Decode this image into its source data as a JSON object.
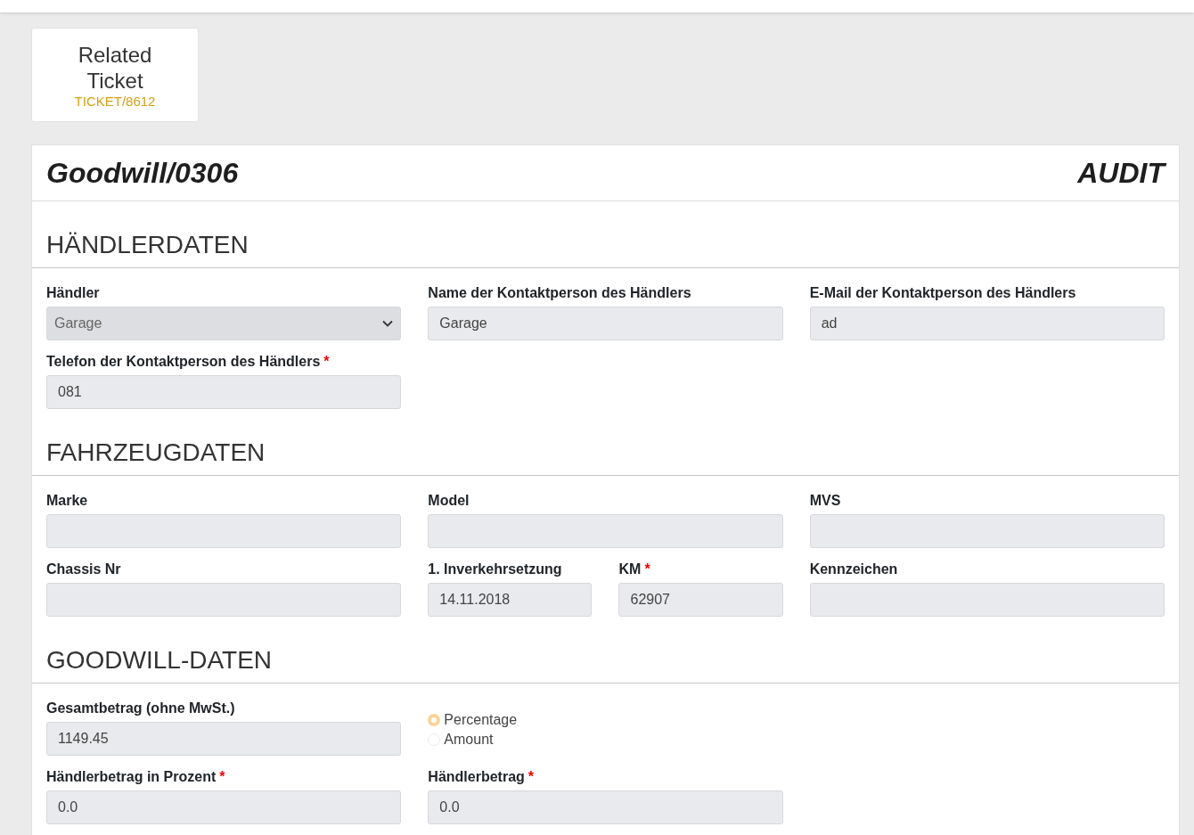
{
  "related_ticket": {
    "title": "Related Ticket",
    "link": "TICKET/8612"
  },
  "record": {
    "title": "Goodwill/0306",
    "status": "AUDIT"
  },
  "sections": [
    {
      "title": "HÄNDLERDATEN",
      "rows": [
        [
          {
            "fields": [
              {
                "kind": "select",
                "label": "Händler",
                "value": "Garage"
              }
            ]
          },
          {
            "fields": [
              {
                "kind": "text",
                "label": "Name der Kontaktperson des Händlers",
                "value": "Garage"
              }
            ]
          },
          {
            "fields": [
              {
                "kind": "text",
                "label": "E-Mail der Kontaktperson des Händlers",
                "value": "ad"
              }
            ]
          }
        ],
        [
          {
            "fields": [
              {
                "kind": "text",
                "label": "Telefon der Kontaktperson des Händlers",
                "required_mark": "*",
                "value": "081"
              }
            ]
          }
        ]
      ]
    },
    {
      "title": "FAHRZEUGDATEN",
      "rows": [
        [
          {
            "fields": [
              {
                "kind": "text",
                "label": "Marke"
              }
            ]
          },
          {
            "fields": [
              {
                "kind": "text",
                "label": "Model"
              }
            ]
          },
          {
            "fields": [
              {
                "kind": "text",
                "label": "MVS"
              }
            ]
          }
        ],
        [
          {
            "fields": [
              {
                "kind": "text",
                "label": "Chassis Nr"
              }
            ]
          },
          {
            "fields": [
              {
                "kind": "text",
                "label": "1. Inverkehrsetzung",
                "value": "14.11.2018"
              },
              {
                "kind": "text",
                "label": "KM",
                "required_mark": "*",
                "value": "62907"
              }
            ]
          },
          {
            "fields": [
              {
                "kind": "text",
                "label": "Kennzeichen"
              }
            ]
          }
        ]
      ]
    },
    {
      "title": "GOODWILL-DATEN",
      "rows": [
        [
          {
            "fields": [
              {
                "kind": "text",
                "label": "Gesamtbetrag (ohne MwSt.)",
                "value": "1149.45"
              }
            ]
          },
          {
            "fields": [
              {
                "kind": "radio",
                "options": [
                  {
                    "label": "Percentage",
                    "selected": true
                  },
                  {
                    "label": "Amount",
                    "selected": false
                  }
                ]
              }
            ]
          }
        ],
        [
          {
            "fields": [
              {
                "kind": "text",
                "label": "Händlerbetrag in Prozent",
                "required_mark": "*",
                "value": "0.0"
              }
            ]
          },
          {
            "fields": [
              {
                "kind": "text",
                "label": "Händlerbetrag",
                "required_mark": "*",
                "value": "0.0"
              }
            ]
          }
        ]
      ]
    }
  ]
}
